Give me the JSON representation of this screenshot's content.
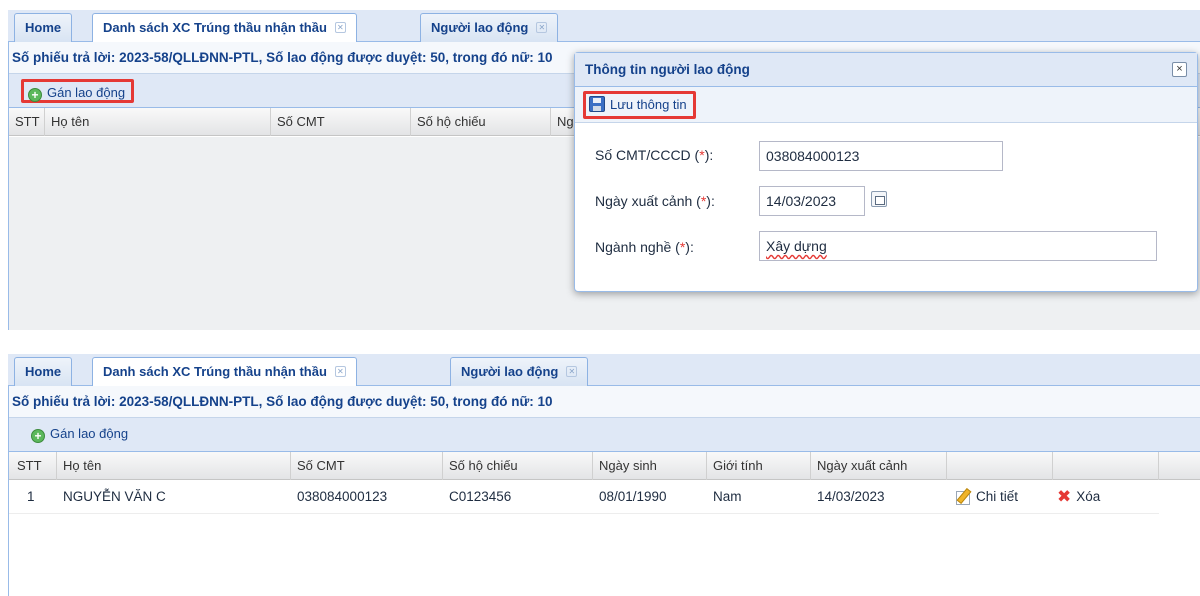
{
  "tabs": [
    {
      "label": "Home"
    },
    {
      "label": "Danh sách XC Trúng thầu nhận thầu"
    },
    {
      "label": "Người lao động"
    }
  ],
  "top_panel": {
    "info_text": "Số phiếu trả lời: 2023-58/QLLĐNN-PTL, Số lao động được duyệt: 50, trong đó nữ: 10",
    "assign_button": "Gán lao động",
    "columns": [
      "STT",
      "Họ tên",
      "Số CMT",
      "Số hộ chiếu",
      "Ngày sinh"
    ]
  },
  "dialog": {
    "title": "Thông tin người lao động",
    "close_symbol": "×",
    "save_label": "Lưu thông tin",
    "fields": {
      "id_label": "Số CMT/CCCD (",
      "id_value": "038084000123",
      "departure_label": "Ngày xuất cảnh (",
      "departure_value": "14/03/2023",
      "occupation_label": "Ngành nghề (",
      "occupation_value": "Xây dựng",
      "required_mark": "*",
      "label_suffix": "):"
    }
  },
  "bottom_panel": {
    "info_text": "Số phiếu trả lời: 2023-58/QLLĐNN-PTL, Số lao động được duyệt: 50, trong đó nữ: 10",
    "assign_button": "Gán lao động",
    "columns": [
      "STT",
      "Họ tên",
      "Số CMT",
      "Số hộ chiếu",
      "Ngày sinh",
      "Giới tính",
      "Ngày xuất cảnh",
      "",
      ""
    ],
    "rows": [
      {
        "stt": "1",
        "name": "NGUYỄN VĂN C",
        "cmt": "038084000123",
        "passport": "C0123456",
        "dob": "08/01/1990",
        "gender": "Nam",
        "departure": "14/03/2023",
        "detail_label": "Chi tiết",
        "delete_label": "Xóa"
      }
    ]
  },
  "icons": {
    "assign": "plus-circle-icon",
    "save": "floppy-disk-icon",
    "detail": "pencil-edit-icon",
    "delete": "red-x-delete-icon",
    "date": "calendar-icon",
    "tab_close": "tab-close-icon"
  },
  "colors": {
    "accent_blue": "#15428b",
    "header_bg": "#dfe8f6",
    "highlight_red": "#e53935",
    "required_red": "#e53935"
  }
}
